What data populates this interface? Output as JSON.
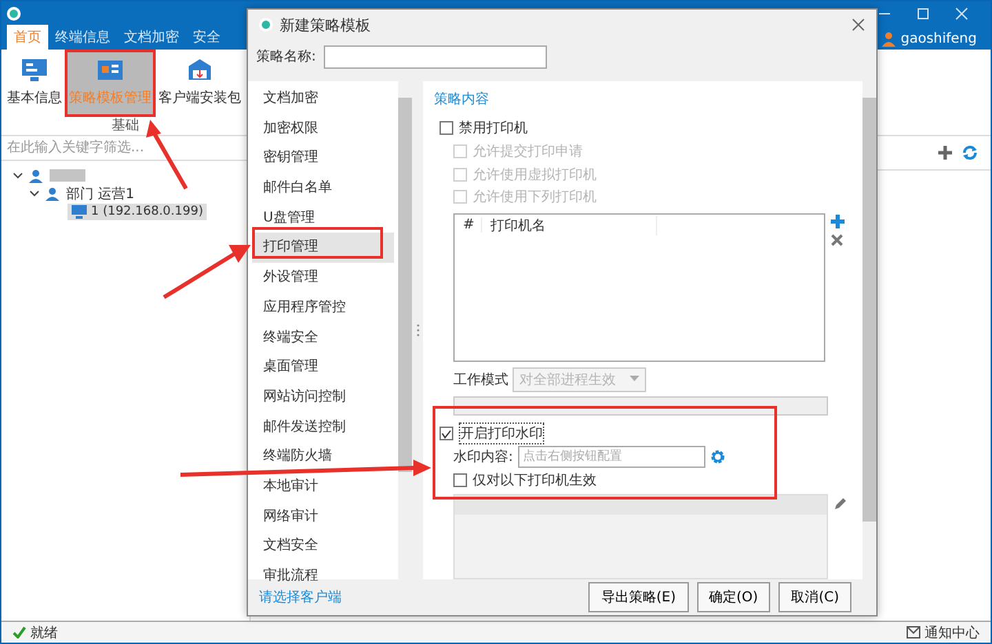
{
  "app": {
    "tabs": [
      {
        "label": "首页",
        "selected": true
      },
      {
        "label": "终端信息",
        "selected": false
      },
      {
        "label": "文档加密",
        "selected": false
      },
      {
        "label": "安全",
        "selected": false
      }
    ],
    "ribbon": {
      "items": [
        {
          "label": "基本信息",
          "selected": false
        },
        {
          "label": "策略模板管理",
          "selected": true
        },
        {
          "label": "客户端安装包",
          "selected": false
        }
      ],
      "group": "基础"
    },
    "user": "gaoshifeng",
    "search": {
      "placeholder": "在此输入关键字筛选..."
    },
    "tree": [
      {
        "expanded": true,
        "children": [
          {
            "label": "部门 运营1",
            "expanded": true,
            "children": [
              {
                "label": "1 (192.168.0.199)",
                "selected": true
              }
            ]
          }
        ]
      }
    ],
    "status_bar": {
      "text": "就绪",
      "notify": "通知中心"
    }
  },
  "dialog": {
    "title": "新建策略模板",
    "name_label": "策略名称:",
    "nav": [
      {
        "label": "文档加密",
        "selected": false
      },
      {
        "label": "加密权限",
        "selected": false
      },
      {
        "label": "密钥管理",
        "selected": false
      },
      {
        "label": "邮件白名单",
        "selected": false
      },
      {
        "label": "U盘管理",
        "selected": false
      },
      {
        "label": "打印管理",
        "selected": true
      },
      {
        "label": "外设管理",
        "selected": false
      },
      {
        "label": "应用程序管控",
        "selected": false
      },
      {
        "label": "终端安全",
        "selected": false
      },
      {
        "label": "桌面管理",
        "selected": false
      },
      {
        "label": "网站访问控制",
        "selected": false
      },
      {
        "label": "邮件发送控制",
        "selected": false
      },
      {
        "label": "终端防火墙",
        "selected": false
      },
      {
        "label": "本地审计",
        "selected": false
      },
      {
        "label": "网络审计",
        "selected": false
      },
      {
        "label": "文档安全",
        "selected": false
      },
      {
        "label": "审批流程",
        "selected": false
      }
    ],
    "section": "策略内容",
    "options": [
      {
        "label": "禁用打印机",
        "checked": false,
        "disabled": false,
        "children": [
          {
            "label": "允许提交打印申请",
            "checked": false,
            "disabled": true
          },
          {
            "label": "允许使用虚拟打印机",
            "checked": false,
            "disabled": true
          },
          {
            "label": "允许使用下列打印机",
            "checked": false,
            "disabled": true
          }
        ]
      }
    ],
    "printer_table": {
      "columns": [
        "#",
        "打印机名"
      ]
    },
    "work_mode": {
      "label": "工作模式",
      "value": "对全部进程生效",
      "disabled": true
    },
    "watermark": {
      "label": "开启打印水印",
      "checked": true,
      "content_label": "水印内容:",
      "content_placeholder": "点击右侧按钮配置",
      "only_label": "仅对以下打印机生效",
      "only_checked": false
    },
    "footer_link": "请选择客户端",
    "buttons": [
      "导出策略(E)",
      "确定(O)",
      "取消(C)"
    ]
  }
}
